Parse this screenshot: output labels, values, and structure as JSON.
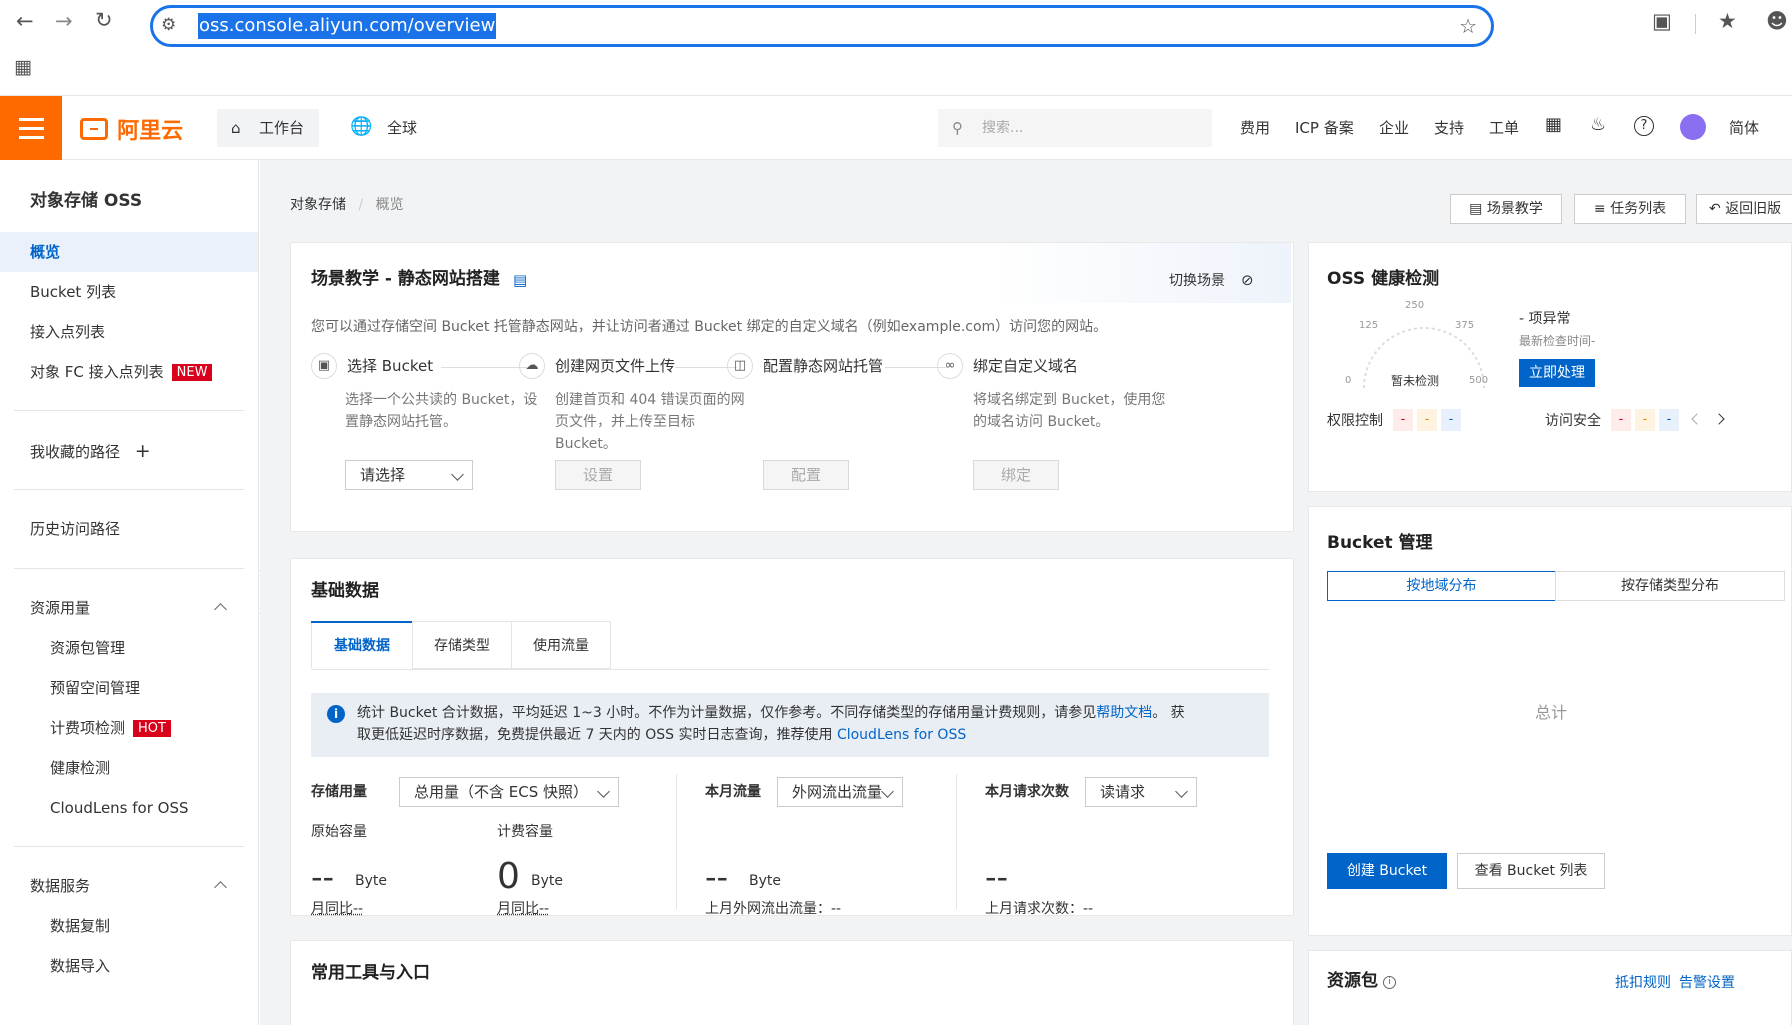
{
  "browser": {
    "url": "oss.console.aliyun.com/overview",
    "back_icon": "arrow-left",
    "forward_icon": "arrow-right",
    "reload_icon": "reload",
    "site_info_icon": "tune",
    "bookmark_icon": "star-outline",
    "extensions_icon": "puzzle",
    "favorites_icon": "star-list",
    "apps_icon": "grid"
  },
  "topnav": {
    "logo_text": "阿里云",
    "workbench": "工作台",
    "region": "全球",
    "search_placeholder": "搜索...",
    "links": [
      "费用",
      "ICP 备案",
      "企业",
      "支持",
      "工单"
    ],
    "lang": "简体"
  },
  "sidebar": {
    "title": "对象存储 OSS",
    "items": {
      "overview": "概览",
      "bucket_list": "Bucket 列表",
      "endpoint_list": "接入点列表",
      "fc_endpoint": "对象 FC 接入点列表",
      "fc_tag": "NEW",
      "favorites": "我收藏的路径",
      "history": "历史访问路径",
      "resource_usage": "资源用量",
      "resource_pkg": "资源包管理",
      "reserved_space": "预留空间管理",
      "billing_check": "计费项检测",
      "billing_tag": "HOT",
      "health_check": "健康检测",
      "cloudlens": "CloudLens for OSS",
      "data_service": "数据服务",
      "data_replication": "数据复制",
      "data_import": "数据导入"
    }
  },
  "breadcrumb": {
    "root": "对象存储",
    "sep": "/",
    "current": "概览"
  },
  "header_buttons": {
    "scene": "场景教学",
    "tasks": "任务列表",
    "back_old": "返回旧版"
  },
  "scene": {
    "title": "场景教学 - 静态网站搭建",
    "switch": "切换场景",
    "desc": "您可以通过存储空间 Bucket 托管静态网站，并让访问者通过 Bucket 绑定的自定义域名（例如example.com）访问您的网站。",
    "steps": [
      {
        "title": "选择 Bucket",
        "desc1": "选择一个公共读的 Bucket，设",
        "desc2": "置静态网站托管。",
        "desc3": "",
        "action": "请选择"
      },
      {
        "title": "创建网页文件上传",
        "desc1": "创建首页和 404 错误页面的网",
        "desc2": "页文件，并上传至目标",
        "desc3": "Bucket。",
        "action": "设置"
      },
      {
        "title": "配置静态网站托管",
        "desc1": "",
        "desc2": "",
        "desc3": "",
        "action": "配置"
      },
      {
        "title": "绑定自定义域名",
        "desc1": "将域名绑定到 Bucket，使用您",
        "desc2": "的域名访问 Bucket。",
        "desc3": "",
        "action": "绑定"
      }
    ]
  },
  "basic": {
    "title": "基础数据",
    "tabs": [
      "基础数据",
      "存储类型",
      "使用流量"
    ],
    "notice_line1_a": "统计 Bucket 合计数据，平均延迟 1~3 小时。不作为计量数据，仅作参考。不同存储类型的存储用量计费规则，请参见",
    "notice_link1": "帮助文档",
    "notice_line1_b": "。 获",
    "notice_line2": "取更低延迟时序数据，免费提供最近 7 天内的 OSS 实时日志查询，推荐使用 ",
    "notice_link2": "CloudLens for OSS",
    "storage_label": "存储用量",
    "storage_select": "总用量（不含 ECS 快照）",
    "traffic_label": "本月流量",
    "traffic_select": "外网流出流量",
    "requests_label": "本月请求次数",
    "requests_select": "读请求",
    "raw_capacity": "原始容量",
    "billing_capacity": "计费容量",
    "raw_value": "--",
    "billing_value": "0",
    "traffic_value": "--",
    "requests_value": "--",
    "unit": "Byte",
    "mom": "月同比--",
    "last_traffic": "上月外网流出流量：--",
    "last_requests": "上月请求次数：--"
  },
  "tools_title": "常用工具与入口",
  "health": {
    "title": "OSS 健康检测",
    "gauge_ticks": [
      "0",
      "125",
      "250",
      "375",
      "500"
    ],
    "gauge_center": "暂未检测",
    "abnormal": "- 项异常",
    "last_check": "最新检查时间-",
    "fix_btn": "立即处理",
    "perm_label": "权限控制",
    "access_label": "访问安全",
    "dash": "-"
  },
  "bucket_mgmt": {
    "title": "Bucket 管理",
    "tabs": [
      "按地域分布",
      "按存储类型分布"
    ],
    "total": "总计",
    "create_btn": "创建 Bucket",
    "list_btn": "查看 Bucket 列表"
  },
  "resource_pkg": {
    "title": "资源包",
    "rules": "抵扣规则",
    "alert": "告警设置"
  },
  "colors": {
    "brand": "#ff6a00",
    "primary": "#0064c8",
    "hot": "#d9001b",
    "url_highlight": "#1a73e8"
  }
}
